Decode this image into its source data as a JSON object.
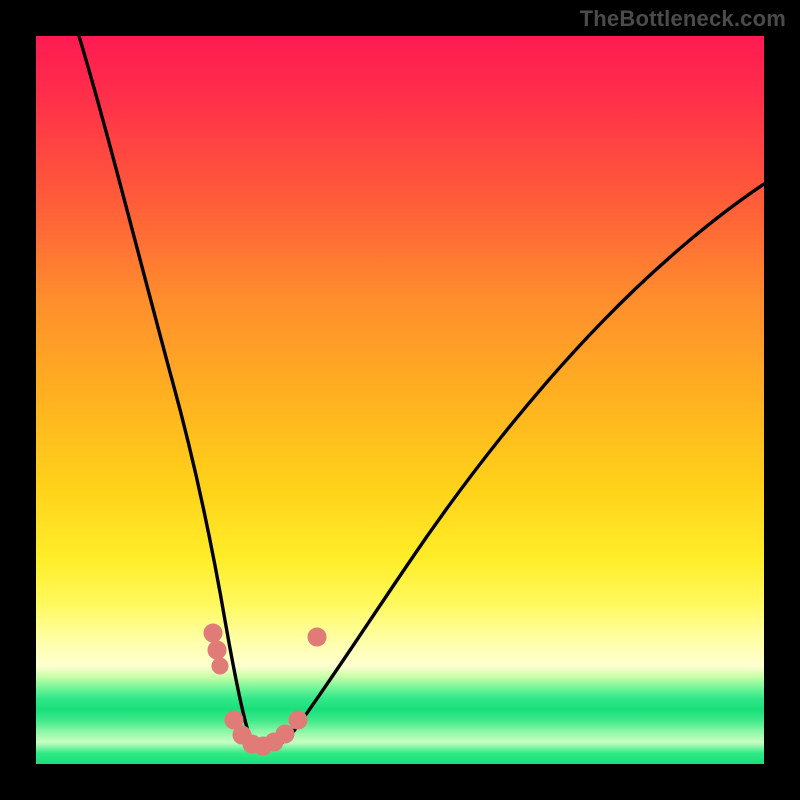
{
  "watermark": "TheBottleneck.com",
  "chart_data": {
    "type": "line",
    "title": "",
    "xlabel": "",
    "ylabel": "",
    "xlim": [
      0,
      100
    ],
    "ylim": [
      0,
      100
    ],
    "note": "Stylized bottleneck curve over a red-to-green vertical gradient. Axes are unlabeled; values are approximate positions in percent of plot area (origin top-left for y).",
    "series": [
      {
        "name": "main-curve",
        "color": "#000000",
        "x": [
          6,
          9,
          12,
          15,
          18,
          21,
          23,
          25,
          27,
          28.5,
          30,
          32,
          35,
          40,
          46,
          52,
          58,
          66,
          74,
          82,
          90,
          100
        ],
        "y": [
          0,
          15,
          30,
          44,
          57,
          68,
          77,
          85,
          91,
          95,
          97,
          97,
          95,
          90,
          83,
          76,
          69,
          60,
          51,
          42,
          34,
          25
        ]
      }
    ],
    "markers": {
      "name": "highlight-dots",
      "color": "#e07b78",
      "points": [
        {
          "x": 24.0,
          "y": 82.0
        },
        {
          "x": 24.5,
          "y": 84.5
        },
        {
          "x": 25.0,
          "y": 87.0
        },
        {
          "x": 27.0,
          "y": 94.0
        },
        {
          "x": 28.0,
          "y": 96.0
        },
        {
          "x": 29.5,
          "y": 97.2
        },
        {
          "x": 31.0,
          "y": 97.3
        },
        {
          "x": 32.5,
          "y": 96.8
        },
        {
          "x": 34.0,
          "y": 95.8
        },
        {
          "x": 36.0,
          "y": 93.8
        },
        {
          "x": 38.5,
          "y": 82.5
        }
      ]
    },
    "gradient_stops": [
      {
        "pos": 0.0,
        "color": "#ff1a52"
      },
      {
        "pos": 0.36,
        "color": "#ff8d2d"
      },
      {
        "pos": 0.62,
        "color": "#ffd21a"
      },
      {
        "pos": 0.86,
        "color": "#ffffd0"
      },
      {
        "pos": 0.91,
        "color": "#31e888"
      },
      {
        "pos": 1.0,
        "color": "#19df7a"
      }
    ]
  }
}
